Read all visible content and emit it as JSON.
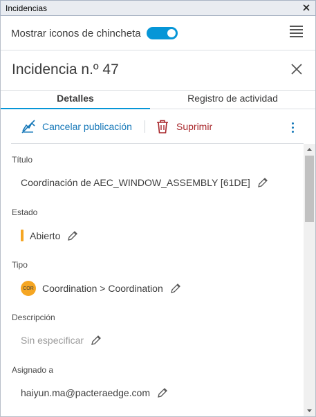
{
  "window": {
    "title": "Incidencias"
  },
  "pins": {
    "label": "Mostrar iconos de chincheta",
    "enabled": true
  },
  "issue": {
    "title": "Incidencia n.º 47"
  },
  "tabs": [
    {
      "label": "Detalles",
      "active": true
    },
    {
      "label": "Registro de actividad",
      "active": false
    }
  ],
  "actions": {
    "unpublish": "Cancelar publicación",
    "delete": "Suprimir"
  },
  "fields": {
    "title": {
      "label": "Título",
      "value": "Coordinación de AEC_WINDOW_ASSEMBLY [61DE]"
    },
    "status": {
      "label": "Estado",
      "value": "Abierto",
      "color": "#f5a623"
    },
    "type": {
      "label": "Tipo",
      "badge": "COR",
      "value": "Coordination > Coordination",
      "color": "#f5a623"
    },
    "description": {
      "label": "Descripción",
      "value": "Sin especificar"
    },
    "assignee": {
      "label": "Asignado a",
      "value": "haiyun.ma@pacteraedge.com"
    }
  },
  "colors": {
    "accent": "#0696d7",
    "link": "#1477b8",
    "danger": "#a8262a"
  }
}
